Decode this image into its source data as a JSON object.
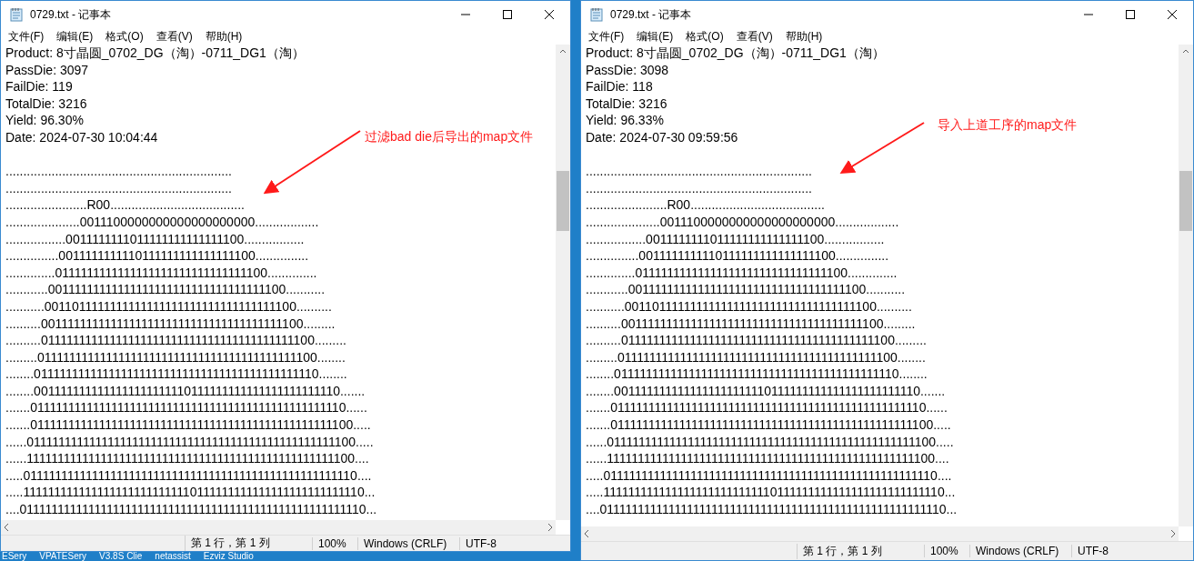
{
  "windows": [
    {
      "title": "0729.txt - 记事本",
      "menu": [
        "文件(F)",
        "编辑(E)",
        "格式(O)",
        "查看(V)",
        "帮助(H)"
      ],
      "header": [
        "Product: 8寸晶圆_0702_DG（淘）-0711_DG1（淘）",
        "PassDie: 3097",
        "FailDie: 119",
        "TotalDie: 3216",
        "Yield: 96.30%",
        "Date: 2024-07-30 10:04:44"
      ],
      "map": [
        "................................................................",
        "................................................................",
        ".......................R00......................................",
        ".....................0011100000000000000000000..................",
        ".................0011111111011111111111111100.................",
        "...............0011111111110111111111111111100...............",
        "..............0111111111111111111111111111111100..............",
        "............00111111111111111111111111111111111100...........",
        "...........0011011111111111111111111111111111111100..........",
        "..........001111111111111111111111111111111111111100.........",
        "..........01111111111111111111111111111111111111111100.........",
        ".........011111111111111111111111111111111111111111100........",
        "........0111111111111111111111111111111111111111111110........",
        "........0011111111111111111111110111111111111111111111110.......",
        ".......011111111111111111111111111111111111111111111111110......",
        ".......0111111111111111111111111111111111111111111111111100.....",
        "......01111111111111111111111111111111111111111111111111100.....",
        "......11111111111111111111111111111111111111111111111111100....",
        ".....011111111111111111111111111111111111111111111111111110....",
        ".....1111111111111111111111111110111111111111111111111111110...",
        "....01111111111111111111111111111111111111111111111111111110..."
      ],
      "annotation": "过滤bad die后导出的map文件",
      "status": {
        "position": "第 1 行，第 1 列",
        "zoom": "100%",
        "line_ending": "Windows (CRLF)",
        "encoding": "UTF-8"
      }
    },
    {
      "title": "0729.txt - 记事本",
      "menu": [
        "文件(F)",
        "编辑(E)",
        "格式(O)",
        "查看(V)",
        "帮助(H)"
      ],
      "header": [
        "Product: 8寸晶圆_0702_DG（淘）-0711_DG1（淘）",
        "PassDie: 3098",
        "FailDie: 118",
        "TotalDie: 3216",
        "Yield: 96.33%",
        "Date: 2024-07-30 09:59:56"
      ],
      "map": [
        "................................................................",
        "................................................................",
        ".......................R00......................................",
        ".....................0011100000000000000000000..................",
        ".................0011111111011111111111111100.................",
        "...............0011111111110111111111111111100...............",
        "..............0111111111111111111111111111111100..............",
        "............00111111111111111111111111111111111100...........",
        "...........0011011111111111111111111111111111111100..........",
        "..........001111111111111111111111111111111111111100.........",
        "..........01111111111111111111111111111111111111111100.........",
        ".........011111111111111111111111111111111111111111100........",
        "........0111111111111111111111111111111111111111111110........",
        "........0011111111111111111111110111111111111111111111110.......",
        ".......011111111111111111111111111111111111111111111111110......",
        ".......0111111111111111111111111111111111111111111111111100.....",
        "......01111111111111111111111111111111111111111111111111100.....",
        "......11111111111111111111111111111111111111111111111111100....",
        ".....011111111111111111111111111111111111111111111111111110....",
        ".....1111111111111111111111111110111111111111111111111111110...",
        "....01111111111111111111111111111111111111111111111111111110..."
      ],
      "annotation": "导入上道工序的map文件",
      "status": {
        "position": "第 1 行，第 1 列",
        "zoom": "100%",
        "line_ending": "Windows (CRLF)",
        "encoding": "UTF-8"
      }
    }
  ],
  "taskbar": {
    "items": [
      "ESery",
      "VPATESery",
      "V3.8S Clie",
      "netassist",
      "Ezviz Studio"
    ]
  }
}
